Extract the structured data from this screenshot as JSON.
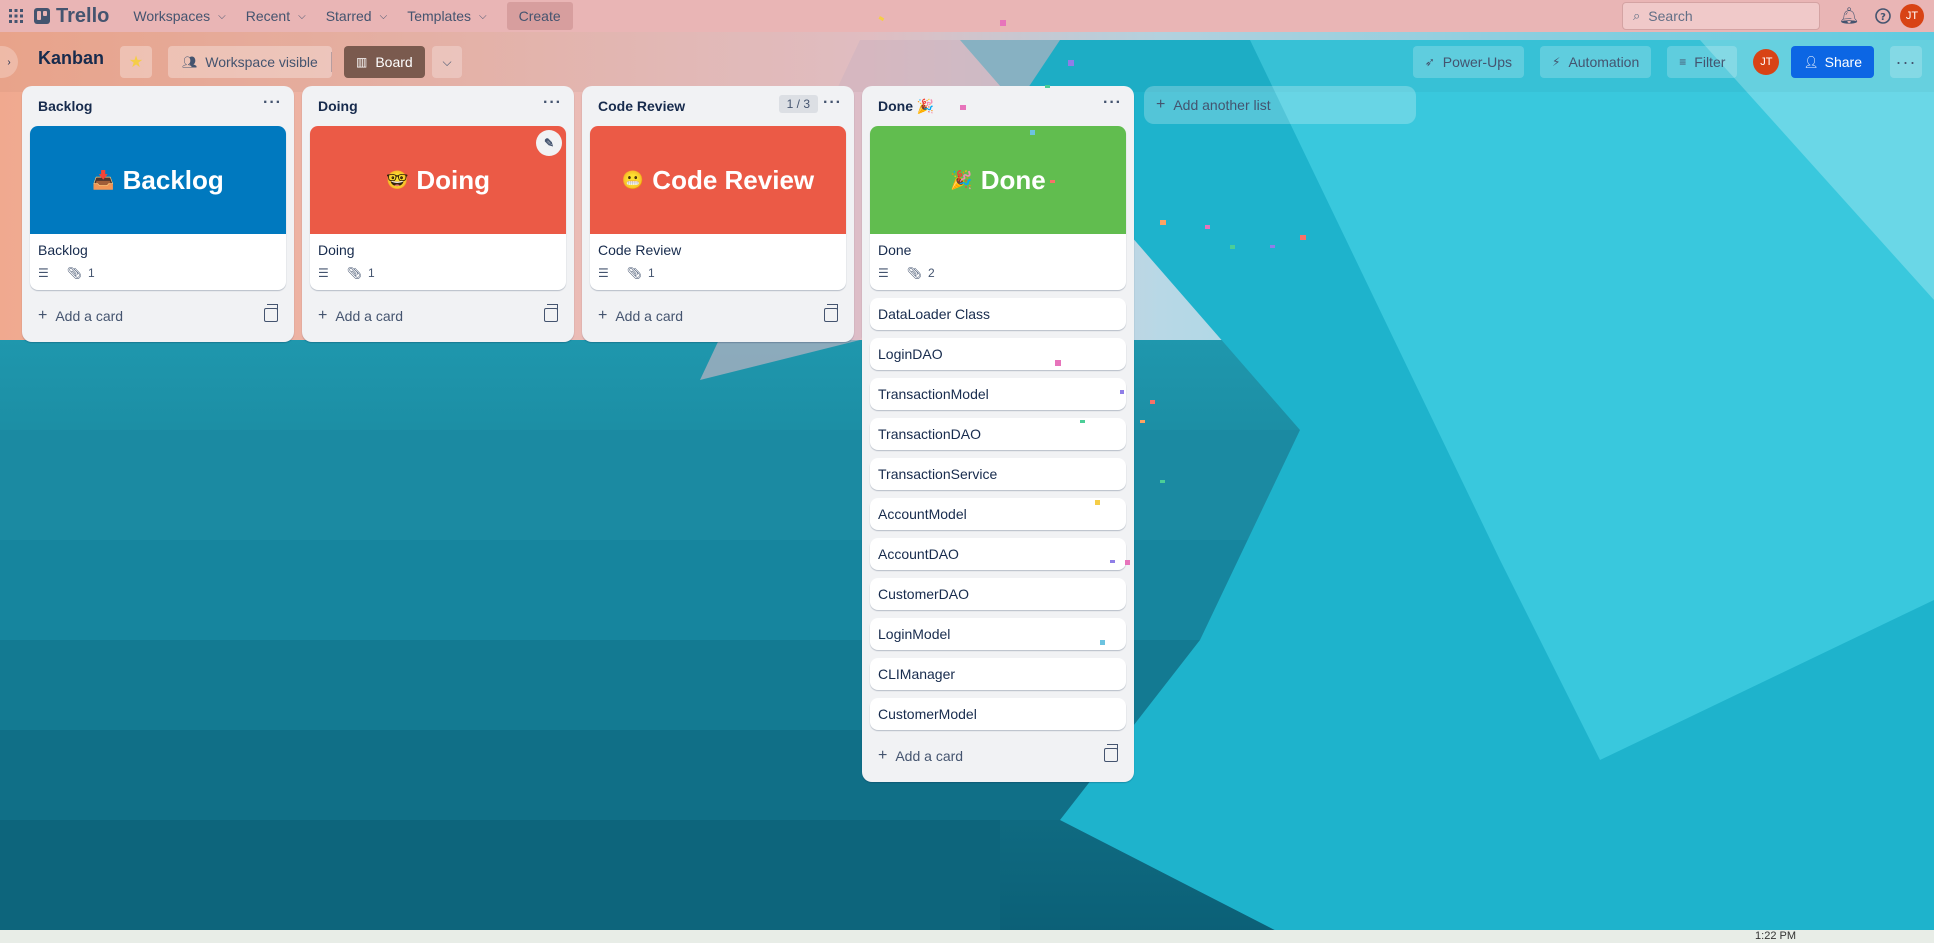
{
  "topnav": {
    "brand": "Trello",
    "menus": [
      "Workspaces",
      "Recent",
      "Starred",
      "Templates"
    ],
    "create_label": "Create",
    "search_placeholder": "Search",
    "avatar_initials": "JT"
  },
  "board": {
    "title": "Kanban",
    "visibility_label": "Workspace visible",
    "view_label": "Board",
    "powerups_label": "Power-Ups",
    "automation_label": "Automation",
    "filter_label": "Filter",
    "share_label": "Share",
    "member_initials": "JT"
  },
  "lists": [
    {
      "title": "Backlog",
      "cover": {
        "emoji": "📥",
        "text": "Backlog",
        "color": "#0079bf"
      },
      "card_title": "Backlog",
      "attachments": "1",
      "add_label": "Add a card"
    },
    {
      "title": "Doing",
      "cover": {
        "emoji": "🤓",
        "text": "Doing",
        "color": "#eb5a46"
      },
      "card_title": "Doing",
      "attachments": "1",
      "add_label": "Add a card"
    },
    {
      "title": "Code Review",
      "limit": "1 / 3",
      "cover": {
        "emoji": "😬",
        "text": "Code Review",
        "color": "#eb5a46"
      },
      "card_title": "Code Review",
      "attachments": "1",
      "add_label": "Add a card"
    },
    {
      "title": "Done 🎉",
      "cover": {
        "emoji": "🎉",
        "text": "Done",
        "color": "#61bd4f"
      },
      "card_title": "Done",
      "attachments": "2",
      "cards": [
        "DataLoader Class",
        "LoginDAO",
        "TransactionModel",
        "TransactionDAO",
        "TransactionService",
        "AccountModel",
        "AccountDAO",
        "CustomerDAO",
        "LoginModel",
        "CLIManager",
        "CustomerModel"
      ],
      "add_label": "Add a card"
    }
  ],
  "add_list_label": "Add another list",
  "taskbar": {
    "time": "1:22 PM"
  }
}
